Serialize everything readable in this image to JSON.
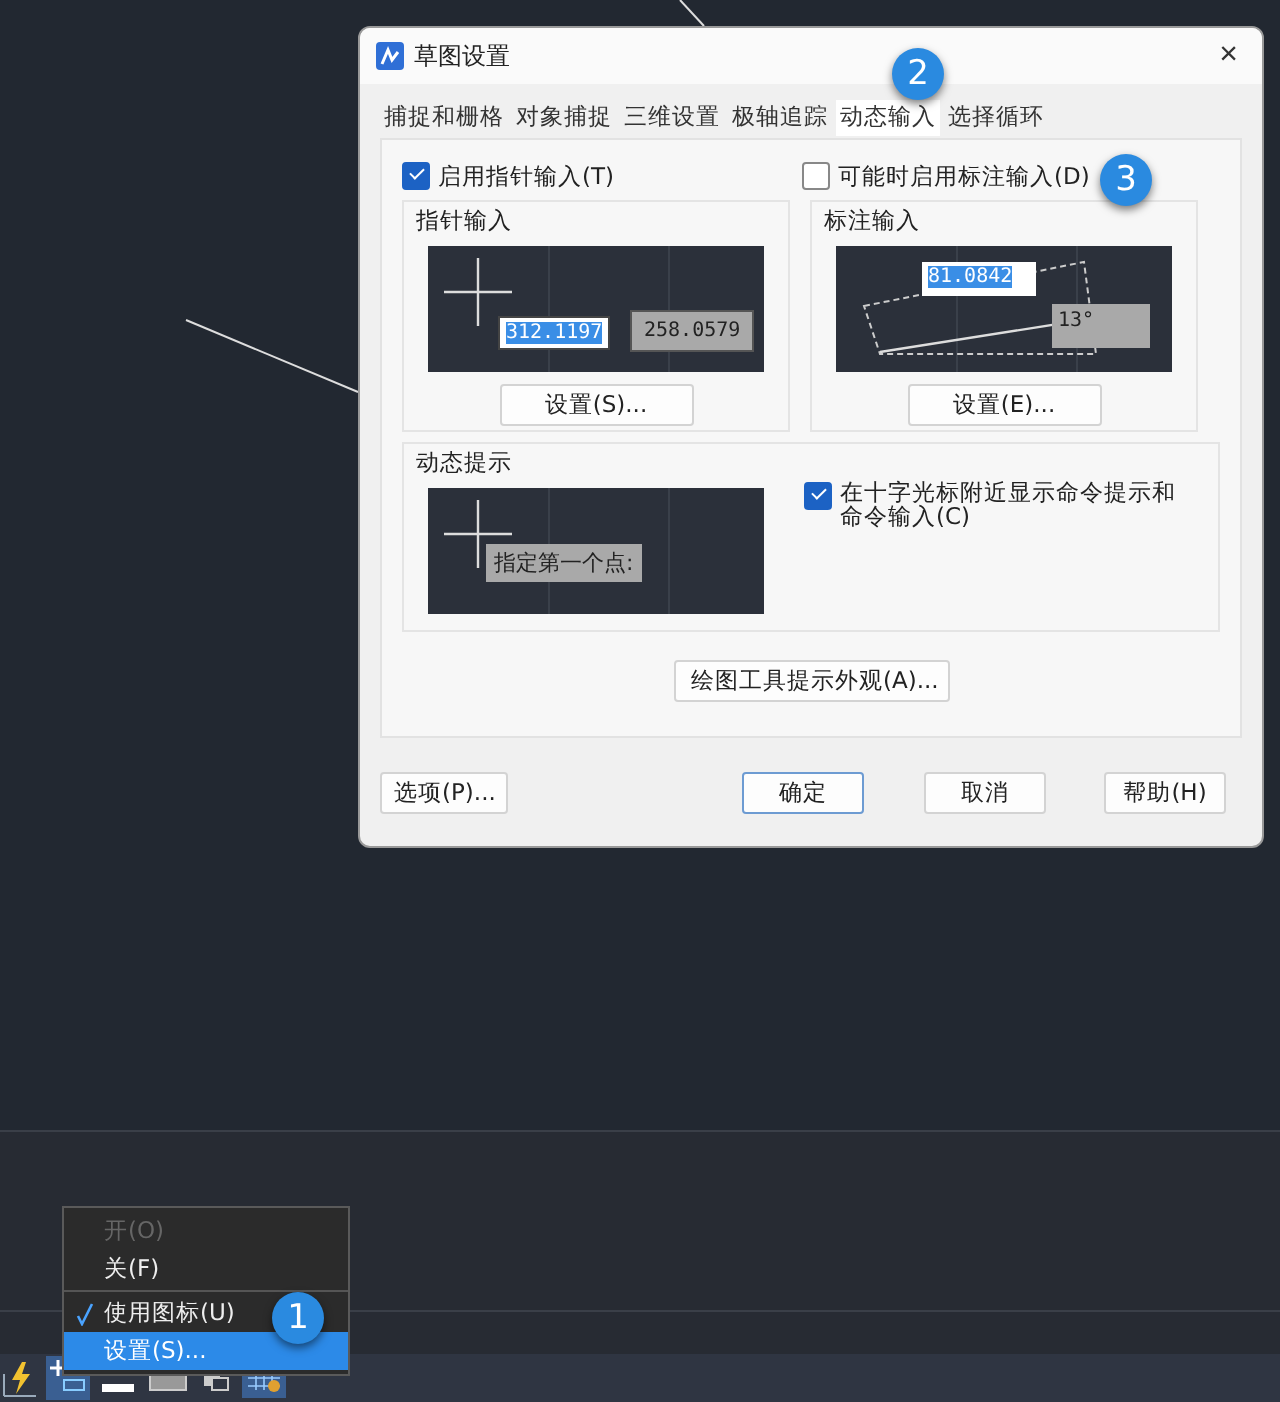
{
  "dialog": {
    "title": "草图设置",
    "close": "×",
    "tabs": [
      {
        "label": "捕捉和栅格",
        "selected": false
      },
      {
        "label": "对象捕捉",
        "selected": false
      },
      {
        "label": "三维设置",
        "selected": false
      },
      {
        "label": "极轴追踪",
        "selected": false
      },
      {
        "label": "动态输入",
        "selected": true
      },
      {
        "label": "选择循环",
        "selected": false
      }
    ],
    "pointer_input": {
      "label": "启用指针输入(T)",
      "checked": true
    },
    "dimension_input": {
      "label": "可能时启用标注输入(D)",
      "checked": false
    },
    "pointer_group": {
      "title": "指针输入",
      "values": [
        "312.1197",
        "258.0579"
      ],
      "button": "设置(S)..."
    },
    "dimension_group": {
      "title": "标注输入",
      "value": "81.0842",
      "angle": "13°",
      "button": "设置(E)..."
    },
    "dynamic_prompt": {
      "title": "动态提示",
      "prompt": "指定第一个点:",
      "checkbox": {
        "label": "在十字光标附近显示命令提示和命令输入(C)",
        "checked": true
      }
    },
    "appearance_button": "绘图工具提示外观(A)...",
    "footer_buttons": [
      {
        "label": "选项(P)...",
        "default": false
      },
      {
        "label": "确定",
        "default": true
      },
      {
        "label": "取消",
        "default": false
      },
      {
        "label": "帮助(H)",
        "default": false
      }
    ]
  },
  "context_menu": {
    "items": [
      {
        "label": "开(O)",
        "disabled": true,
        "checked": false,
        "selected": false
      },
      {
        "label": "关(F)",
        "disabled": false,
        "checked": false,
        "selected": false
      },
      {
        "label": "使用图标(U)",
        "disabled": false,
        "checked": true,
        "selected": false
      },
      {
        "label": "设置(S)...",
        "disabled": false,
        "checked": false,
        "selected": true
      }
    ]
  },
  "callouts": [
    "2",
    "3",
    "1"
  ]
}
